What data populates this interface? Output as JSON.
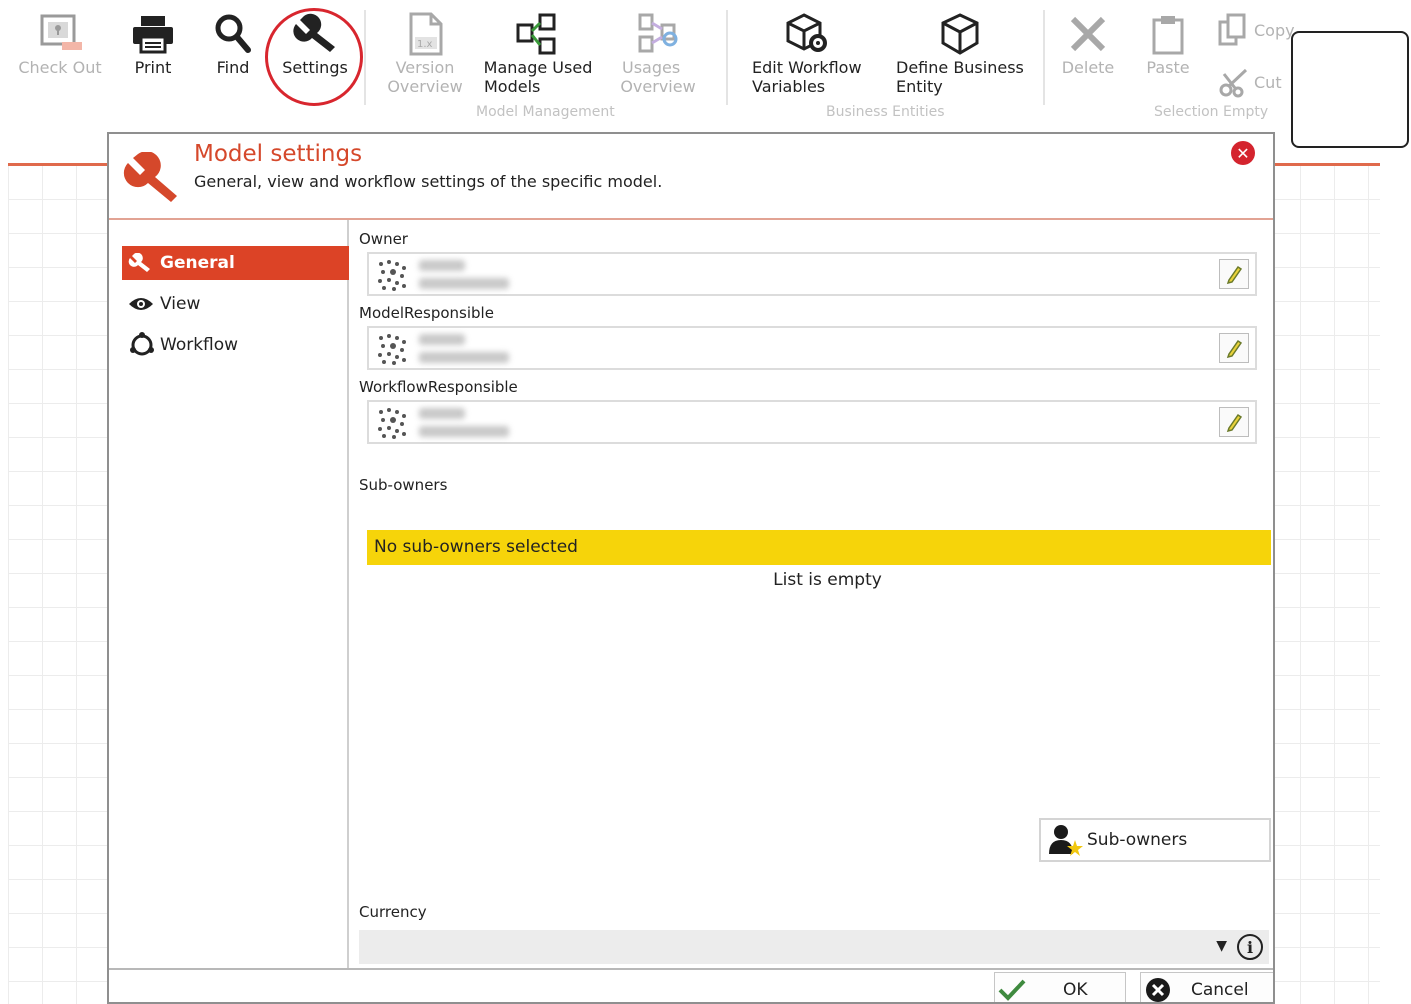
{
  "ribbon": {
    "check_out": "Check Out",
    "print": "Print",
    "find": "Find",
    "settings": "Settings",
    "version_overview": [
      "Version",
      "Overview"
    ],
    "manage_used_models": [
      "Manage Used",
      "Models"
    ],
    "usages_overview": [
      "Usages",
      "Overview"
    ],
    "edit_workflow_variables": [
      "Edit Workflow",
      "Variables"
    ],
    "define_business_entity": [
      "Define Business",
      "Entity"
    ],
    "delete": "Delete",
    "paste": "Paste",
    "copy": "Copy",
    "cut": "Cut",
    "groups": {
      "model_management": "Model Management",
      "business_entities": "Business Entities",
      "selection_empty": "Selection Empty"
    }
  },
  "dialog": {
    "title": "Model settings",
    "subtitle": "General, view and workflow settings of the specific model.",
    "close_symbol": "✕",
    "nav": [
      {
        "label": "General",
        "icon": "wrench-icon",
        "active": true
      },
      {
        "label": "View",
        "icon": "eye-icon",
        "active": false
      },
      {
        "label": "Workflow",
        "icon": "workflow-icon",
        "active": false
      }
    ],
    "fields": {
      "owner_label": "Owner",
      "model_responsible_label": "ModelResponsible",
      "workflow_responsible_label": "WorkflowResponsible",
      "sub_owners_label": "Sub-owners",
      "no_sub_owners": "No sub-owners selected",
      "list_empty": "List is empty",
      "sub_owners_button": "Sub-owners",
      "currency_label": "Currency",
      "currency_value": "",
      "info_symbol": "i"
    },
    "footer": {
      "ok": "OK",
      "cancel": "Cancel"
    }
  },
  "colors": {
    "accent": "#dc4326",
    "title": "#d5482b",
    "highlight": "#f6d40a",
    "settings_circle": "#d8262e"
  }
}
